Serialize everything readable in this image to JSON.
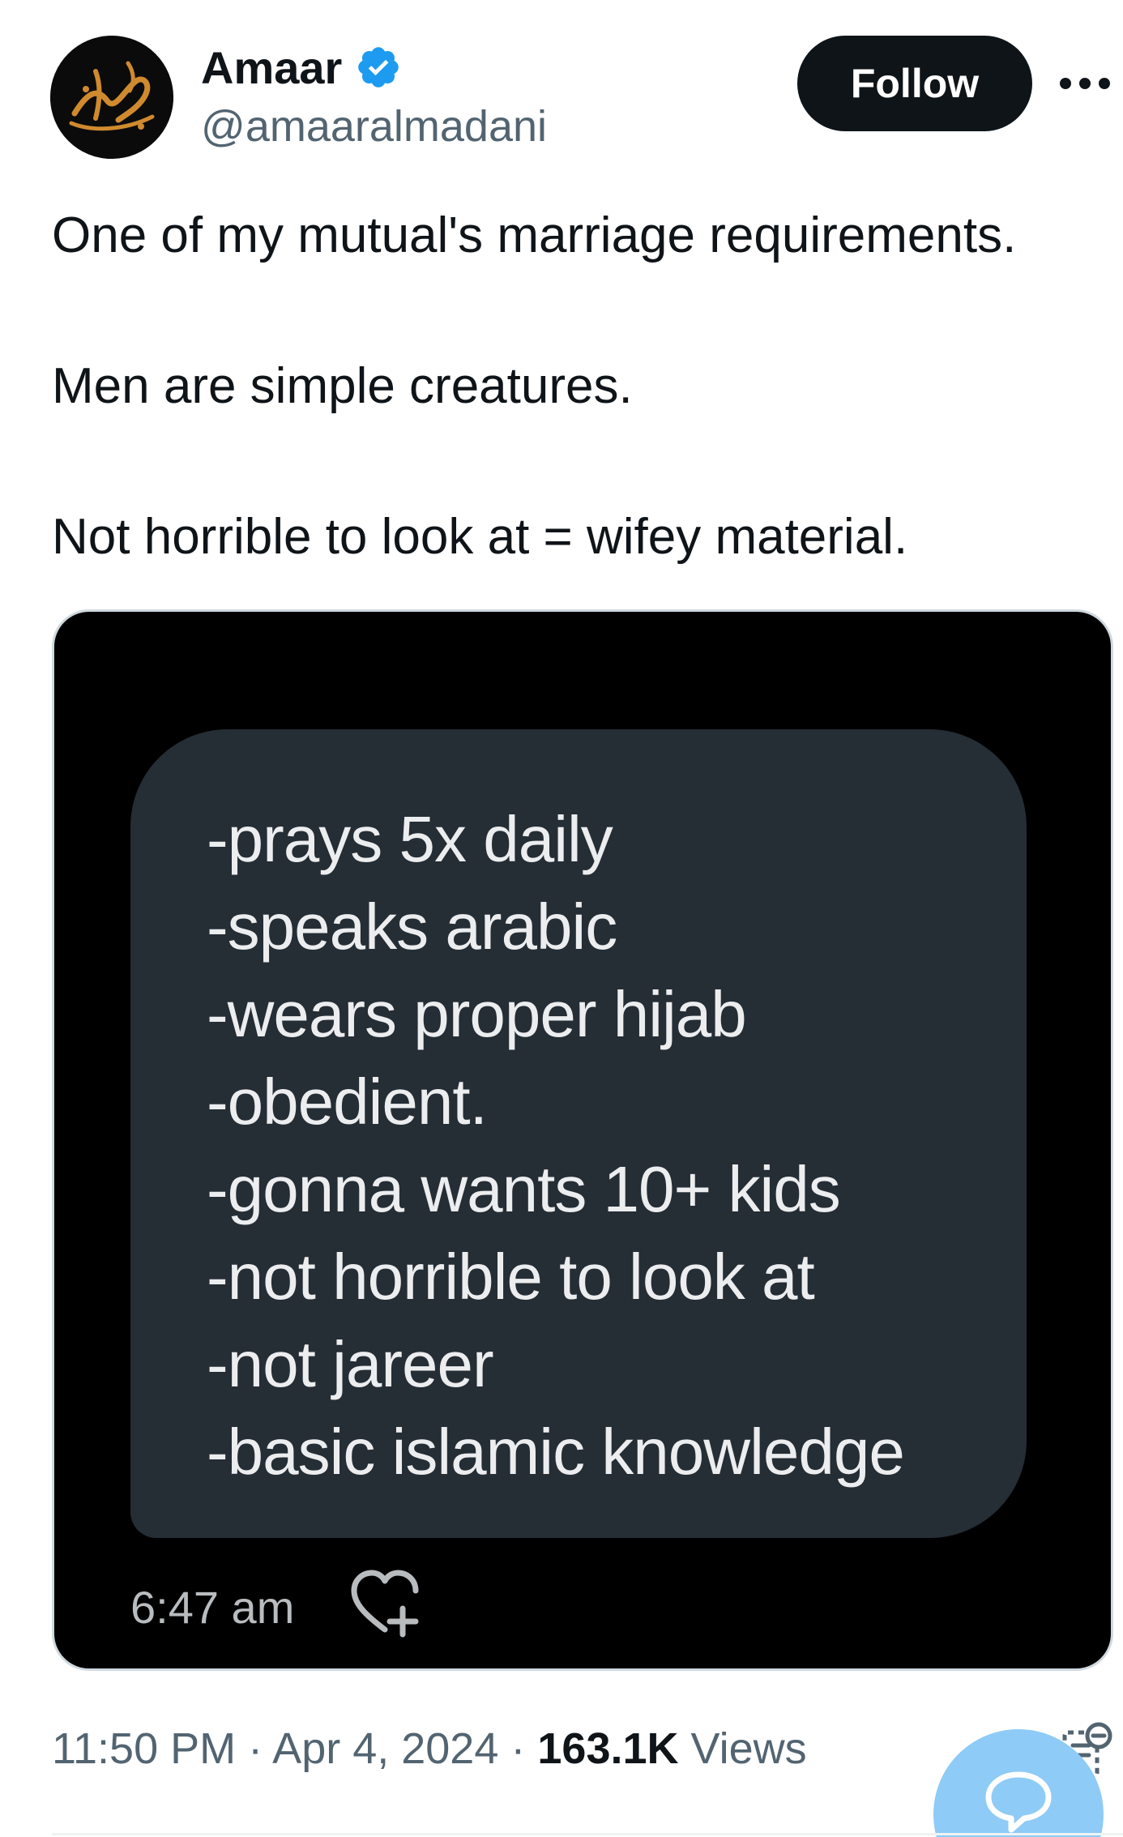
{
  "author": {
    "display_name": "Amaar",
    "handle": "@amaaralmadani",
    "verified": true,
    "avatar_icon": "arabic-calligraphy-logo"
  },
  "header": {
    "follow_label": "Follow",
    "more_icon": "more-horizontal-icon"
  },
  "tweet": {
    "paragraphs": [
      "One of my mutual's marriage requirements.",
      "Men are simple creatures.",
      "Not horrible to look at = wifey material."
    ]
  },
  "media": {
    "message_lines": [
      "-prays 5x daily",
      "-speaks arabic",
      "-wears proper hijab",
      "-obedient.",
      "-gonna wants 10+ kids",
      "-not horrible to look at",
      "-not jareer",
      "-basic islamic knowledge"
    ],
    "message_time": "6:47 am",
    "reaction_icon": "heart-plus-icon"
  },
  "meta": {
    "time": "11:50 PM",
    "separator": "·",
    "date": "Apr 4, 2024",
    "views_count": "163.1K",
    "views_label": "Views"
  },
  "colors": {
    "follow_bg": "#0f1419",
    "verified": "#1d9bf0",
    "secondary_text": "#536471",
    "bubble": "#252d35",
    "fab": "#8ecbf6"
  }
}
